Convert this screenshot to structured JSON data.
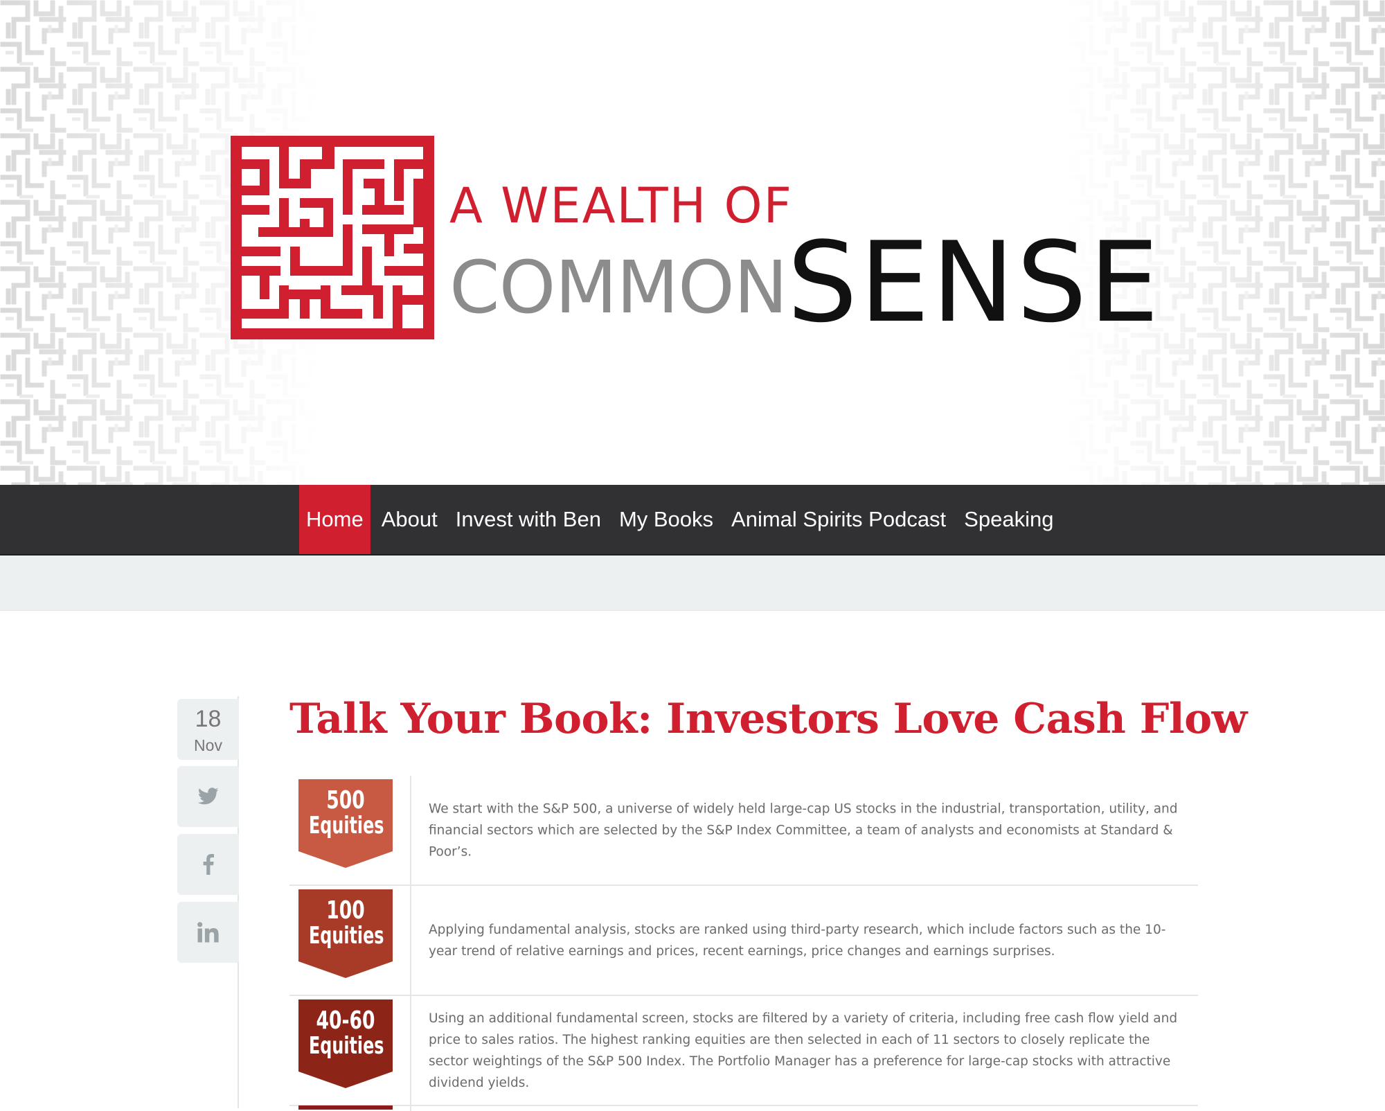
{
  "logo": {
    "line1": "A WEALTH OF",
    "line2_common": "COMMON",
    "line2_sense": "SENSE",
    "mark_icon": "maze-icon",
    "colors": {
      "red": "#d0202f",
      "grey": "#8c8c8c",
      "black": "#111111"
    }
  },
  "nav": {
    "items": [
      {
        "label": "Home",
        "active": true
      },
      {
        "label": "About",
        "active": false
      },
      {
        "label": "Invest with Ben",
        "active": false
      },
      {
        "label": "My Books",
        "active": false
      },
      {
        "label": "Animal Spirits Podcast",
        "active": false
      },
      {
        "label": "Speaking",
        "active": false
      }
    ],
    "background": "#313133",
    "active_color": "#d0202f"
  },
  "post": {
    "date": {
      "day": "18",
      "month": "Nov"
    },
    "share": [
      {
        "network": "twitter",
        "icon": "twitter-icon"
      },
      {
        "network": "facebook",
        "icon": "facebook-icon"
      },
      {
        "network": "linkedin",
        "icon": "linkedin-icon"
      }
    ],
    "title": "Talk Your Book: Investors Love Cash Flow",
    "title_color": "#d0202f",
    "steps": [
      {
        "badge_number": "500",
        "badge_label": "Equities",
        "badge_color": "#c85a44",
        "description": "We start with the S&P 500, a universe of widely held large-cap US stocks in the industrial, transportation, utility, and financial sectors which are selected by the S&P Index Committee, a team of analysts and economists at Standard & Poor’s."
      },
      {
        "badge_number": "100",
        "badge_label": "Equities",
        "badge_color": "#a83a28",
        "description": "Applying fundamental analysis, stocks are ranked using third-party research, which include factors such as the 10-year trend of relative earnings and prices, recent earnings, price changes and earnings surprises."
      },
      {
        "badge_number": "40-60",
        "badge_label": "Equities",
        "badge_color": "#8c2418",
        "description": "Using an additional fundamental screen, stocks are filtered by a variety of criteria, including free cash flow yield and price to sales ratios. The highest ranking equities are then selected in each of 11 sectors to closely replicate the sector weightings of the S&P 500 Index. The Portfolio Manager has a preference for large-cap stocks with attractive dividend yields."
      }
    ]
  }
}
